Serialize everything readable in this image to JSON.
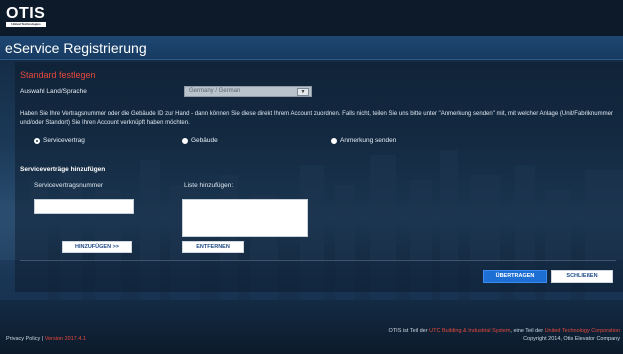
{
  "brand": {
    "logo_text": "OTIS",
    "logo_tagline": "United Technologies"
  },
  "header": {
    "title": "eService Registrierung"
  },
  "form": {
    "section_heading": "Standard festlegen",
    "country_label": "Auswahl Land/Sprache",
    "country_value": "Germany / German",
    "instructions": "Haben Sie Ihre Vertragsnummer oder die Gebäude ID zur Hand - dann können Sie diese direkt Ihrem Account zuordnen. Falls nicht, teilen Sie uns bitte unter \"Anmerkung senden\" mit, mit welcher Anlage (Unit/Fabriknummer und/oder Standort) Sie Ihren Account verknüpft haben möchten.",
    "radio_options": [
      {
        "label": "Servicevertrag",
        "selected": true
      },
      {
        "label": "Gebäude",
        "selected": false
      },
      {
        "label": "Anmerkung senden",
        "selected": false
      }
    ],
    "subsection_heading": "Serviceverträge hinzufügen",
    "contract_number_label": "Servicevertragsnummer",
    "contract_number_value": "",
    "list_label": "Liste hinzufügen:",
    "add_button": "HINZUFÜGEN >>",
    "remove_button": "ENTFERNEN",
    "submit_button": "ÜBERTRAGEN",
    "close_button": "SCHLIEßEN"
  },
  "footer": {
    "privacy_link": "Privacy Policy",
    "separator": "|",
    "version": "Version 2017.4.1",
    "otis_part_text": "OTIS ist Teil der",
    "utc_bis_link": "UTC Building & Industrial System",
    "part_of_text": ", eine Teil der",
    "utc_link": "United Technology Corporation",
    "copyright": "Copyright 2014, Otis Elevator Company"
  },
  "colors": {
    "accent_red": "#e8493b",
    "primary_blue": "#1d6fd4",
    "header_dark": "#0d1a2a"
  }
}
